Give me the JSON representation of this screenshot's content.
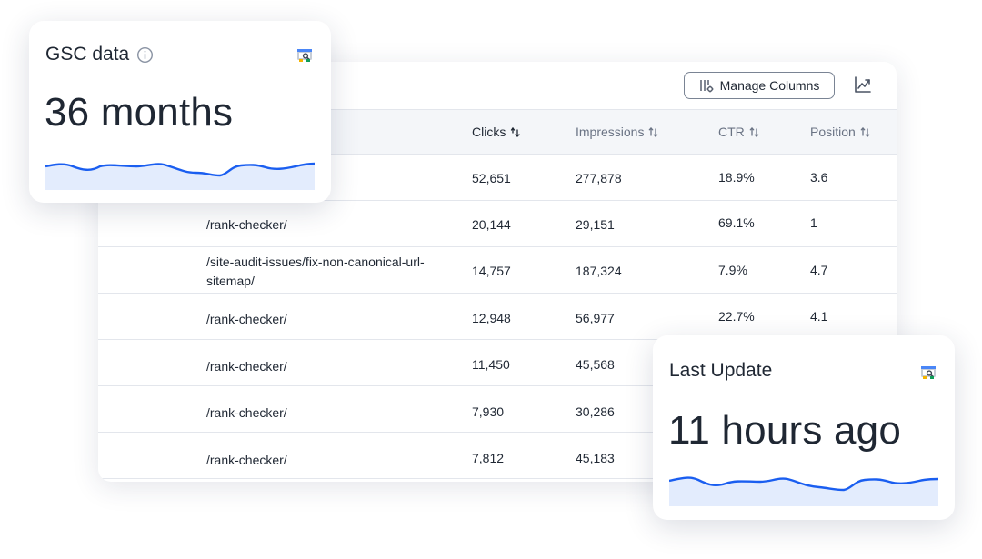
{
  "toolbar": {
    "manage_columns_label": "Manage Columns"
  },
  "table": {
    "columns": [
      {
        "label": "Clicks",
        "sorted": true
      },
      {
        "label": "Impressions"
      },
      {
        "label": "CTR"
      },
      {
        "label": "Position"
      }
    ],
    "rows": [
      {
        "url": "",
        "clicks": "52,651",
        "impressions": "277,878",
        "ctr": "18.9%",
        "position": "3.6"
      },
      {
        "url": "/rank-checker/",
        "clicks": "20,144",
        "impressions": "29,151",
        "ctr": "69.1%",
        "position": "1"
      },
      {
        "url": "/site-audit-issues/fix-non-canonical-url-sitemap/",
        "clicks": "14,757",
        "impressions": "187,324",
        "ctr": "7.9%",
        "position": "4.7"
      },
      {
        "url": "/rank-checker/",
        "clicks": "12,948",
        "impressions": "56,977",
        "ctr": "22.7%",
        "position": "4.1"
      },
      {
        "url": "/rank-checker/",
        "clicks": "11,450",
        "impressions": "45,568",
        "ctr": "",
        "position": ""
      },
      {
        "url": "/rank-checker/",
        "clicks": "7,930",
        "impressions": "30,286",
        "ctr": "",
        "position": ""
      },
      {
        "url": "/rank-checker/",
        "clicks": "7,812",
        "impressions": "45,183",
        "ctr": "",
        "position": ""
      }
    ]
  },
  "gsc_card": {
    "title": "GSC data",
    "value": "36 months",
    "icon": "google-search-console-icon"
  },
  "update_card": {
    "title": "Last Update",
    "value": "11 hours ago",
    "icon": "google-search-console-icon"
  },
  "colors": {
    "accent": "#1a5ef0",
    "spark_fill": "#e3ecfd",
    "header_bg": "#f4f6f9",
    "border": "#e3e6ec"
  }
}
